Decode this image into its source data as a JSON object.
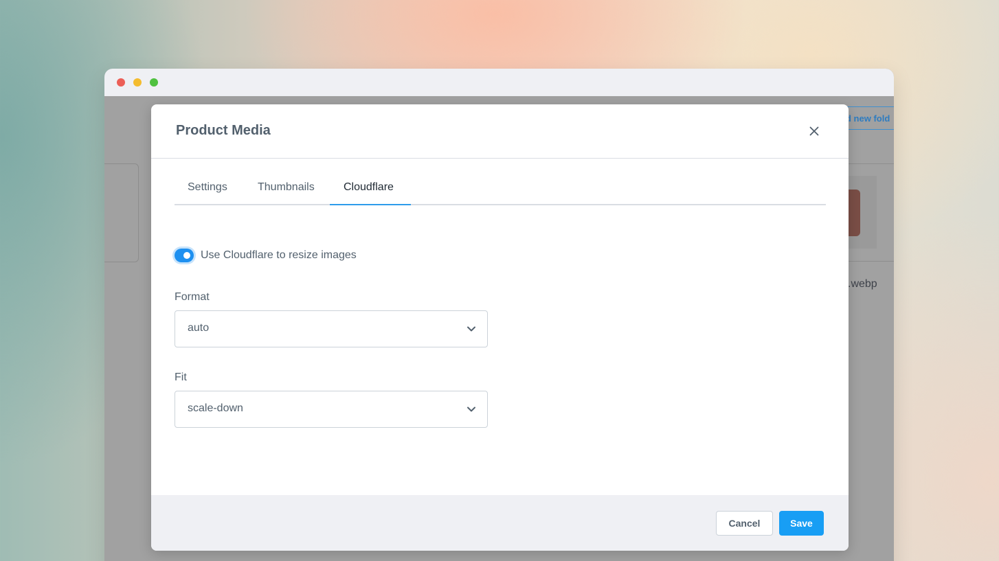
{
  "window": {
    "traffic_lights": [
      "close",
      "minimize",
      "zoom"
    ]
  },
  "background_app": {
    "add_folder_button": "d new fold",
    "file_name": ".webp"
  },
  "modal": {
    "title": "Product Media",
    "close_icon": "close-icon",
    "tabs": [
      {
        "label": "Settings",
        "active": false
      },
      {
        "label": "Thumbnails",
        "active": false
      },
      {
        "label": "Cloudflare",
        "active": true
      }
    ],
    "cloudflare": {
      "toggle_label": "Use Cloudflare to resize images",
      "toggle_on": true,
      "format": {
        "label": "Format",
        "value": "auto"
      },
      "fit": {
        "label": "Fit",
        "value": "scale-down"
      }
    },
    "footer": {
      "cancel_label": "Cancel",
      "save_label": "Save"
    }
  },
  "colors": {
    "accent": "#189ef4",
    "toggle": "#1e90f0",
    "tab_underline": "#2d9ceb",
    "text": "#52606d"
  }
}
